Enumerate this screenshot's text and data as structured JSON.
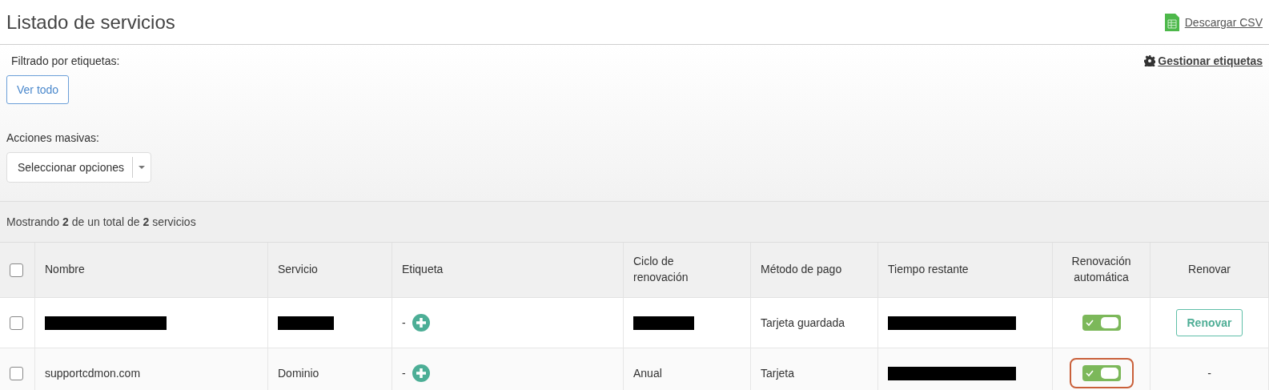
{
  "page_title": "Listado de servicios",
  "download_link": "Descargar CSV",
  "filter": {
    "label": "Filtrado por etiquetas:",
    "manage_link": "Gestionar etiquetas",
    "button": "Ver todo"
  },
  "bulk_actions": {
    "label": "Acciones masivas:",
    "select": "Seleccionar opciones"
  },
  "summary": "Mostrando **2** de un total de **2** servicios",
  "table": {
    "select_all_checked": false,
    "columns": [
      "Nombre",
      "Servicio",
      "Etiqueta",
      "Ciclo de renovación",
      "Método de pago",
      "Tiempo restante",
      "Renovación automática",
      "Renovar"
    ],
    "rows": [
      {
        "checked": false,
        "nombre": {
          "kind": "redacted"
        },
        "servicio": {
          "kind": "redacted"
        },
        "etiqueta": "-",
        "ciclo": {
          "kind": "redacted"
        },
        "metodo": {
          "kind": "text",
          "text": "Tarjeta guardada"
        },
        "tiempo": {
          "kind": "redacted"
        },
        "auto_renew": {
          "on": true,
          "highlighted": false
        },
        "renovar": {
          "kind": "button",
          "text": "Renovar"
        }
      },
      {
        "checked": false,
        "nombre": {
          "kind": "text",
          "text": "supportcdmon.com"
        },
        "servicio": {
          "kind": "text",
          "text": "Dominio"
        },
        "etiqueta": "-",
        "ciclo": {
          "kind": "text",
          "text": "Anual"
        },
        "metodo": {
          "kind": "text",
          "text": "Tarjeta"
        },
        "tiempo": {
          "kind": "redacted"
        },
        "auto_renew": {
          "on": true,
          "highlighted": true
        },
        "renovar": {
          "kind": "text",
          "text": "-"
        }
      }
    ]
  }
}
